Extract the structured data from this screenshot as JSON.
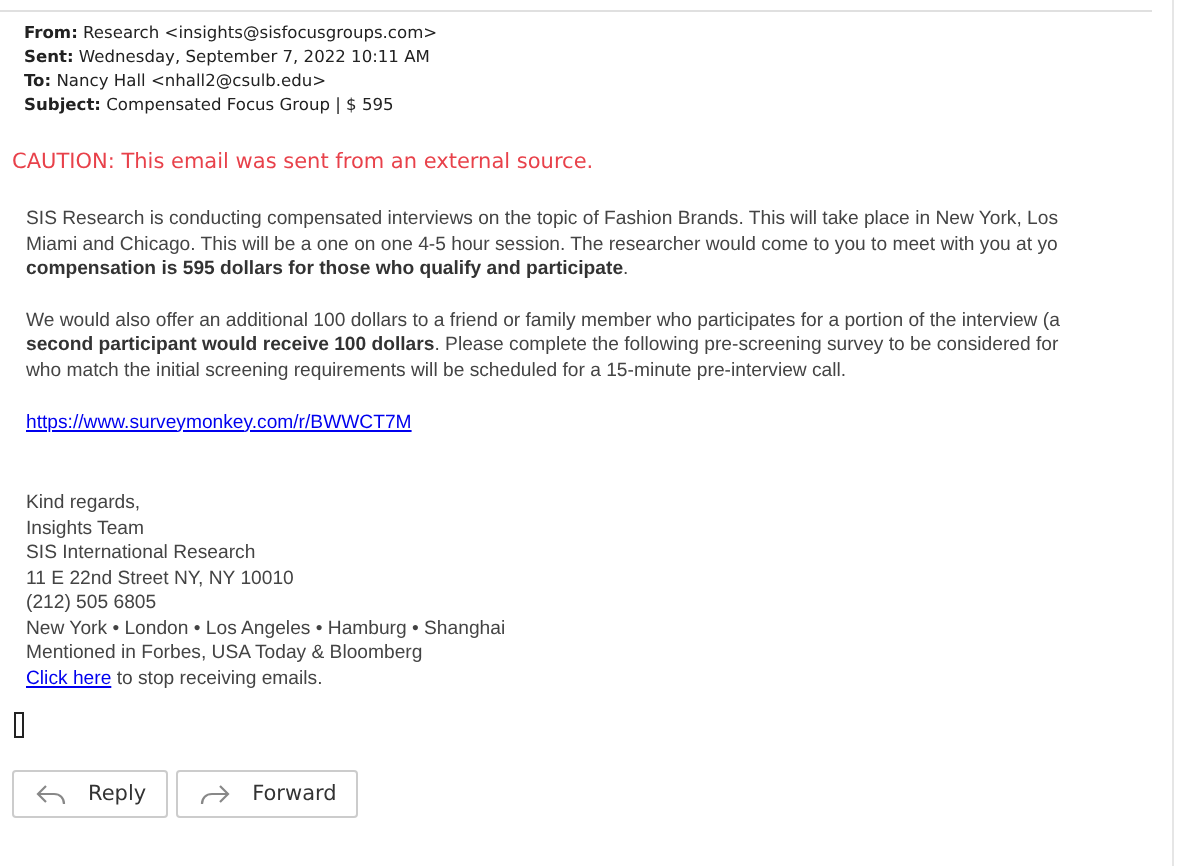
{
  "header": [
    {
      "label": "From:",
      "value": "Research <insights@sisfocusgroups.com>"
    },
    {
      "label": "Sent:",
      "value": "Wednesday, September 7, 2022 10:11 AM"
    },
    {
      "label": "To:",
      "value": "Nancy Hall <nhall2@csulb.edu>"
    },
    {
      "label": "Subject:",
      "value": "Compensated Focus Group | $ 595"
    }
  ],
  "caution": "CAUTION: This email was sent from an external source.",
  "paragraphs": [
    "SIS Research is conducting compensated interviews on the topic of Fashion Brands. This will take place in New York, Los\nMiami and Chicago. This will be a one on one 4-5 hour session. The researcher would come to you to meet with you at yo\n**compensation is 595 dollars for those who qualify and participate**.",
    "We would also offer an additional 100 dollars to a friend or family member who participates for a portion of the interview (a\n**second participant would receive 100 dollars**. Please complete the following pre-screening survey to be considered for\nwho match the initial screening requirements will be scheduled for a 15-minute pre-interview call."
  ],
  "survey_link": "https://www.surveymonkey.com/r/BWWCT7M",
  "signature": [
    "Kind regards,",
    "Insights Team",
    "SIS International Research",
    "11 E 22nd Street NY, NY 10010",
    "(212) 505 6805",
    "New York • London • Los Angeles • Hamburg • Shanghai",
    "Mentioned in Forbes, USA Today & Bloomberg"
  ],
  "unsubscribe": {
    "link": "Click here",
    "text": "to stop receiving emails."
  },
  "buttons": [
    {
      "kind": "reply",
      "label": "Reply"
    },
    {
      "kind": "forward",
      "label": "Forward"
    }
  ]
}
